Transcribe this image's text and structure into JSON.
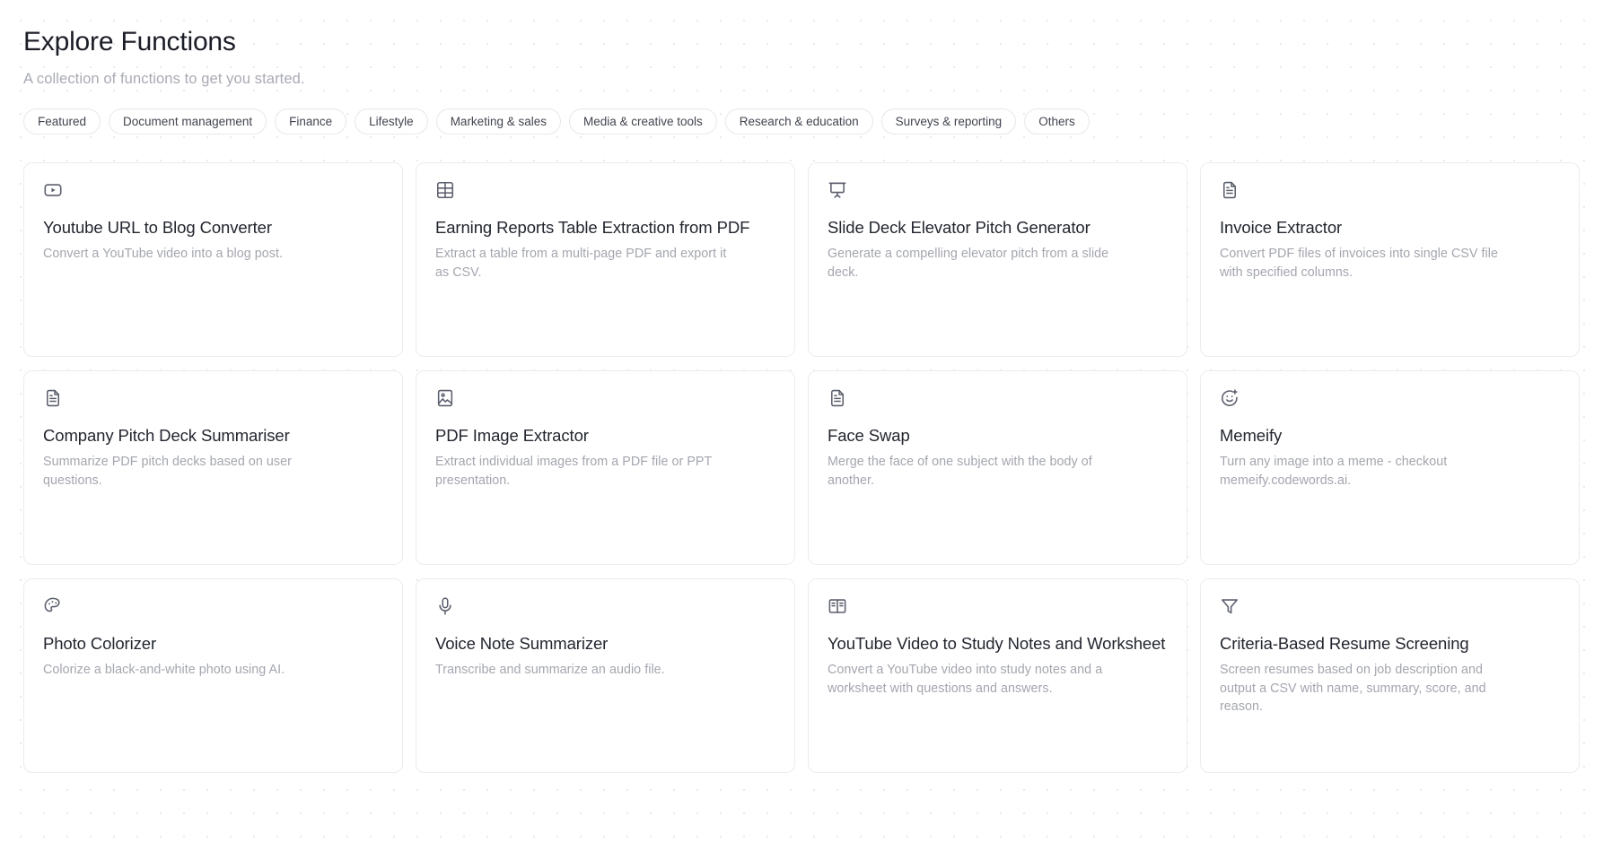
{
  "header": {
    "title": "Explore Functions",
    "subtitle": "A collection of functions to get you started."
  },
  "filters": [
    {
      "label": "Featured",
      "selected": false
    },
    {
      "label": "Document management",
      "selected": false
    },
    {
      "label": "Finance",
      "selected": false
    },
    {
      "label": "Lifestyle",
      "selected": false
    },
    {
      "label": "Marketing & sales",
      "selected": false
    },
    {
      "label": "Media & creative tools",
      "selected": false
    },
    {
      "label": "Research & education",
      "selected": false
    },
    {
      "label": "Surveys & reporting",
      "selected": false
    },
    {
      "label": "Others",
      "selected": false
    }
  ],
  "cards": [
    {
      "icon": "youtube-play-icon",
      "title": "Youtube URL to Blog Converter",
      "description": "Convert a YouTube video into a blog post."
    },
    {
      "icon": "table-grid-icon",
      "title": "Earning Reports Table Extraction from PDF",
      "description": "Extract a table from a multi-page PDF and export it as CSV."
    },
    {
      "icon": "presentation-screen-icon",
      "title": "Slide Deck Elevator Pitch Generator",
      "description": "Generate a compelling elevator pitch from a slide deck."
    },
    {
      "icon": "document-text-icon",
      "title": "Invoice Extractor",
      "description": "Convert PDF files of invoices into single CSV file with specified columns."
    },
    {
      "icon": "document-text-icon",
      "title": "Company Pitch Deck Summariser",
      "description": "Summarize PDF pitch decks based on user questions."
    },
    {
      "icon": "image-file-icon",
      "title": "PDF Image Extractor",
      "description": "Extract individual images from a PDF file or PPT presentation."
    },
    {
      "icon": "document-text-icon",
      "title": "Face Swap",
      "description": "Merge the face of one subject with the body of another."
    },
    {
      "icon": "smiley-plus-icon",
      "title": "Memeify",
      "description": "Turn any image into a meme - checkout memeify.codewords.ai."
    },
    {
      "icon": "palette-icon",
      "title": "Photo Colorizer",
      "description": "Colorize a black-and-white photo using AI."
    },
    {
      "icon": "microphone-icon",
      "title": "Voice Note Summarizer",
      "description": "Transcribe and summarize an audio file."
    },
    {
      "icon": "open-book-icon",
      "title": "YouTube Video to Study Notes and Worksheet",
      "description": "Convert a YouTube video into study notes and a worksheet with questions and answers."
    },
    {
      "icon": "funnel-filter-icon",
      "title": "Criteria-Based Resume Screening",
      "description": "Screen resumes based on job description and output a CSV with name, summary, score, and reason."
    }
  ],
  "colors": {
    "page_background": "#ffffff",
    "dot_grid": "#e9e9ee",
    "title_text": "#1b1d26",
    "muted_text": "#a4a6af",
    "card_border": "#ececf0",
    "icon_stroke": "#5c5f6d"
  }
}
